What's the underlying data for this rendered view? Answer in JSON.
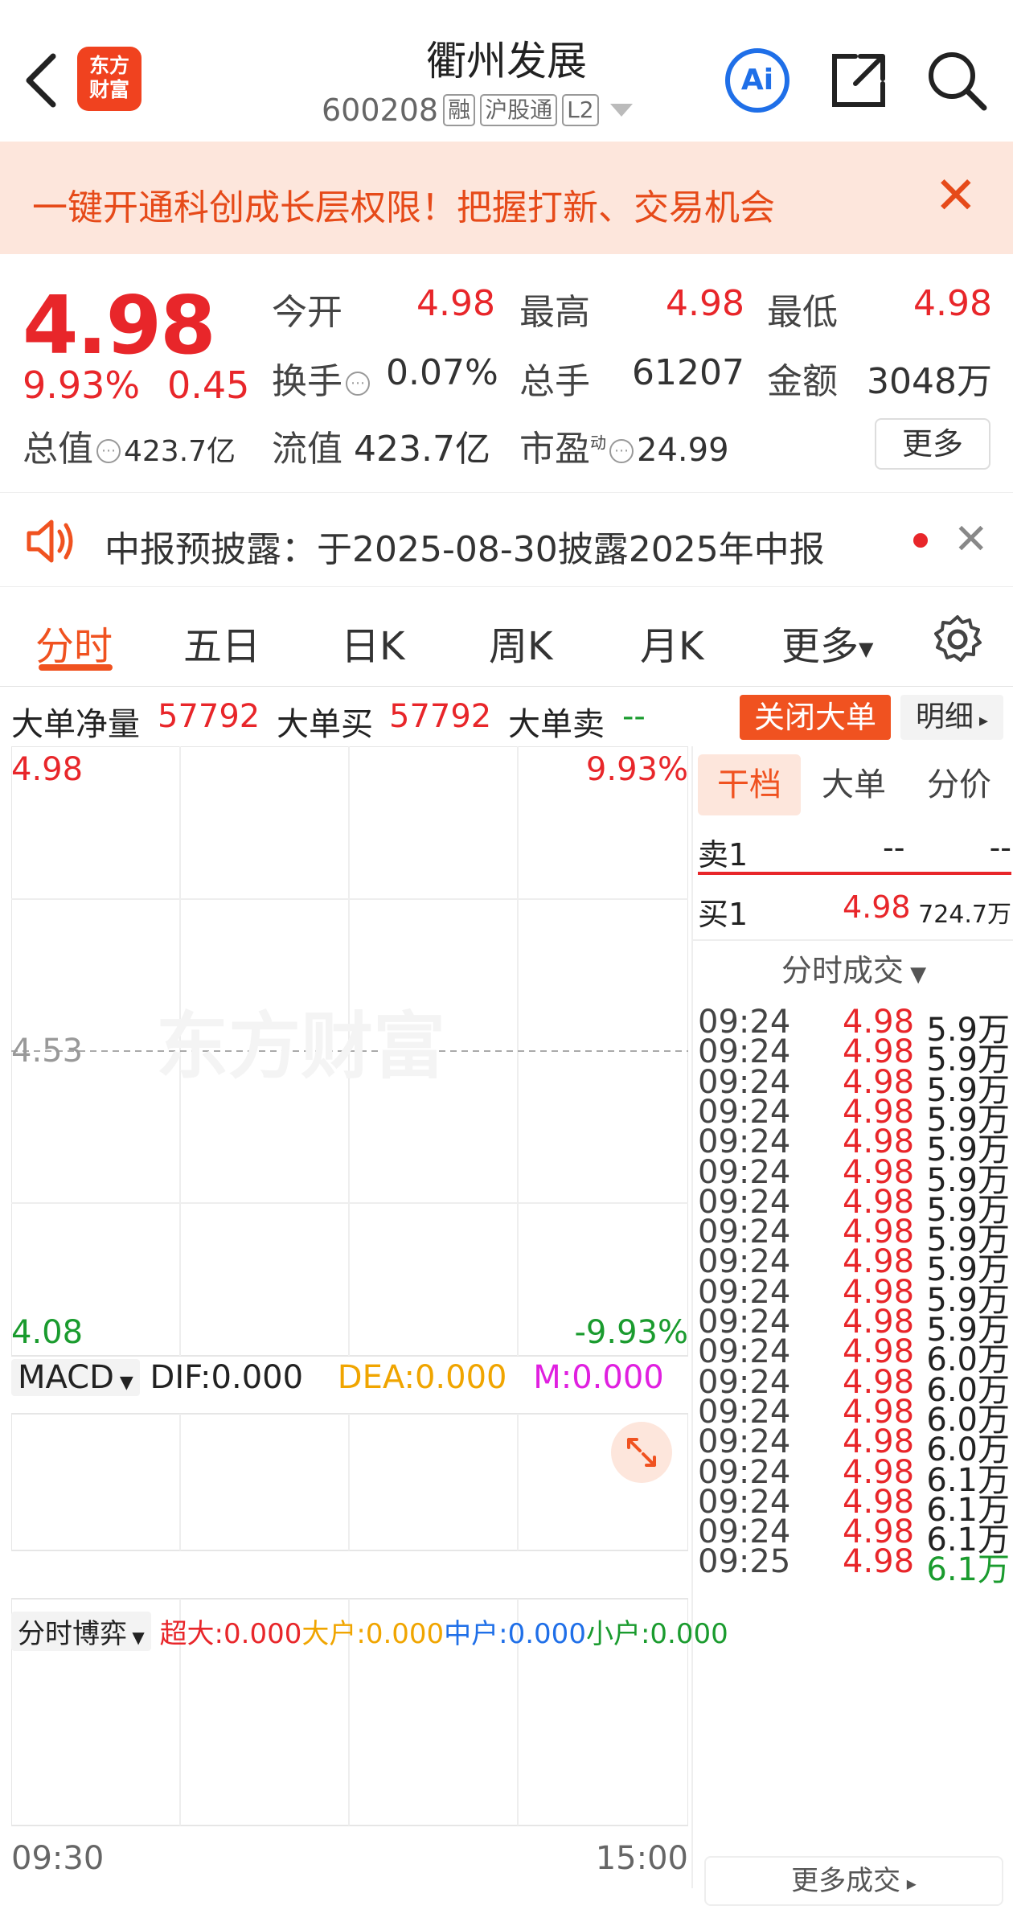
{
  "header": {
    "logo_text": "东方财富",
    "title": "衢州发展",
    "code": "600208",
    "tags": [
      "融",
      "沪股通",
      "L2"
    ],
    "ai_label": "Ai"
  },
  "banner": {
    "text": "一键开通科创成长层权限！把握打新、交易机会",
    "close": "✕"
  },
  "quote": {
    "price": "4.98",
    "change_pct": "9.93%",
    "change": "0.45",
    "open_label": "今开",
    "open": "4.98",
    "high_label": "最高",
    "high": "4.98",
    "low_label": "最低",
    "low": "4.98",
    "turnover_label": "换手",
    "turnover": "0.07%",
    "volume_label": "总手",
    "volume": "61207",
    "amount_label": "金额",
    "amount": "3048万",
    "mcap_label": "总值",
    "mcap": "423.7亿",
    "float_label": "流值",
    "float": "423.7亿",
    "pe_label": "市盈",
    "pe_sup": "动",
    "pe": "24.99",
    "more": "更多"
  },
  "notice": {
    "text": "中报预披露：于2025-08-30披露2025年中报"
  },
  "tabs": [
    "分时",
    "五日",
    "日K",
    "周K",
    "月K",
    "更多"
  ],
  "big_order": {
    "net_label": "大单净量",
    "net": "57792",
    "buy_label": "大单买",
    "buy": "57792",
    "sell_label": "大单卖",
    "sell": "--",
    "close_btn": "关闭大单",
    "detail_btn": "明细"
  },
  "chart_data": {
    "type": "line",
    "price_top": "4.98",
    "price_mid": "4.53",
    "price_bottom": "4.08",
    "pct_top": "9.93%",
    "pct_bottom": "-9.93%",
    "x_start": "09:30",
    "x_end": "15:00",
    "watermark": "东方财富",
    "series": []
  },
  "macd": {
    "selector": "MACD",
    "dif": "DIF:0.000",
    "dea": "DEA:0.000",
    "m": "M:0.000"
  },
  "game": {
    "selector": "分时博弈",
    "super": "超大:0.000",
    "large": "大户:0.000",
    "mid": "中户:0.000",
    "small": "小户:0.000"
  },
  "right_panel": {
    "tabs": [
      "干档",
      "大单",
      "分价"
    ],
    "sell1_label": "卖1",
    "sell1_price": "--",
    "sell1_vol": "--",
    "buy1_label": "买1",
    "buy1_price": "4.98",
    "buy1_vol": "724.7万",
    "ts_header": "分时成交",
    "trades": [
      {
        "t": "09:24",
        "p": "4.98",
        "v": "5.9万"
      },
      {
        "t": "09:24",
        "p": "4.98",
        "v": "5.9万"
      },
      {
        "t": "09:24",
        "p": "4.98",
        "v": "5.9万"
      },
      {
        "t": "09:24",
        "p": "4.98",
        "v": "5.9万"
      },
      {
        "t": "09:24",
        "p": "4.98",
        "v": "5.9万"
      },
      {
        "t": "09:24",
        "p": "4.98",
        "v": "5.9万"
      },
      {
        "t": "09:24",
        "p": "4.98",
        "v": "5.9万"
      },
      {
        "t": "09:24",
        "p": "4.98",
        "v": "5.9万"
      },
      {
        "t": "09:24",
        "p": "4.98",
        "v": "5.9万"
      },
      {
        "t": "09:24",
        "p": "4.98",
        "v": "5.9万"
      },
      {
        "t": "09:24",
        "p": "4.98",
        "v": "5.9万"
      },
      {
        "t": "09:24",
        "p": "4.98",
        "v": "6.0万"
      },
      {
        "t": "09:24",
        "p": "4.98",
        "v": "6.0万"
      },
      {
        "t": "09:24",
        "p": "4.98",
        "v": "6.0万"
      },
      {
        "t": "09:24",
        "p": "4.98",
        "v": "6.0万"
      },
      {
        "t": "09:24",
        "p": "4.98",
        "v": "6.1万"
      },
      {
        "t": "09:24",
        "p": "4.98",
        "v": "6.1万"
      },
      {
        "t": "09:24",
        "p": "4.98",
        "v": "6.1万"
      },
      {
        "t": "09:25",
        "p": "4.98",
        "v": "6.1万"
      }
    ],
    "more_trades": "更多成交"
  },
  "colors": {
    "up": "#e8262a",
    "down": "#1a9b2e",
    "accent": "#f05220",
    "dea": "#f0a500",
    "m": "#e020e0",
    "mid": "#1f6fe8"
  }
}
